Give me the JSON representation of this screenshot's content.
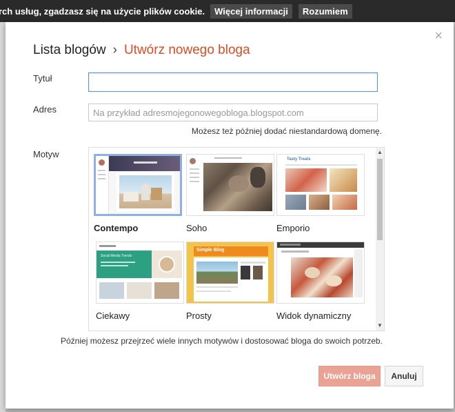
{
  "cookie_bar": {
    "text": "rch usług, zgadzasz się na użycie plików cookie.",
    "more_info": "Więcej informacji",
    "accept": "Rozumiem"
  },
  "dialog": {
    "close": "×",
    "breadcrumb_root": "Lista blogów",
    "breadcrumb_sep": "›",
    "breadcrumb_current": "Utwórz nowego bloga",
    "title_label": "Tytuł",
    "title_value": "",
    "address_label": "Adres",
    "address_placeholder": "Na przykład adresmojegonowegobloga.blogspot.com",
    "address_hint": "Możesz też później dodać niestandardową domenę.",
    "theme_label": "Motyw",
    "themes": [
      {
        "name": "Contempo",
        "selected": true
      },
      {
        "name": "Soho",
        "selected": false
      },
      {
        "name": "Emporio",
        "selected": false
      },
      {
        "name": "Ciekawy",
        "selected": false
      },
      {
        "name": "Prosty",
        "selected": false
      },
      {
        "name": "Widok dynamiczny",
        "selected": false
      }
    ],
    "thumb_text": {
      "emporio": "Tasty Treats",
      "ciekawy": "Social Media Trends",
      "prosty": "Simple Blog"
    },
    "footer_note": "Później możesz przejrzeć wiele innych motywów i dostosować bloga do swoich potrzeb.",
    "create_button": "Utwórz bloga",
    "cancel_button": "Anuluj"
  },
  "colors": {
    "accent": "#dd4b22",
    "focus_border": "#4d90fe",
    "create_button_bg": "#e9a293"
  }
}
